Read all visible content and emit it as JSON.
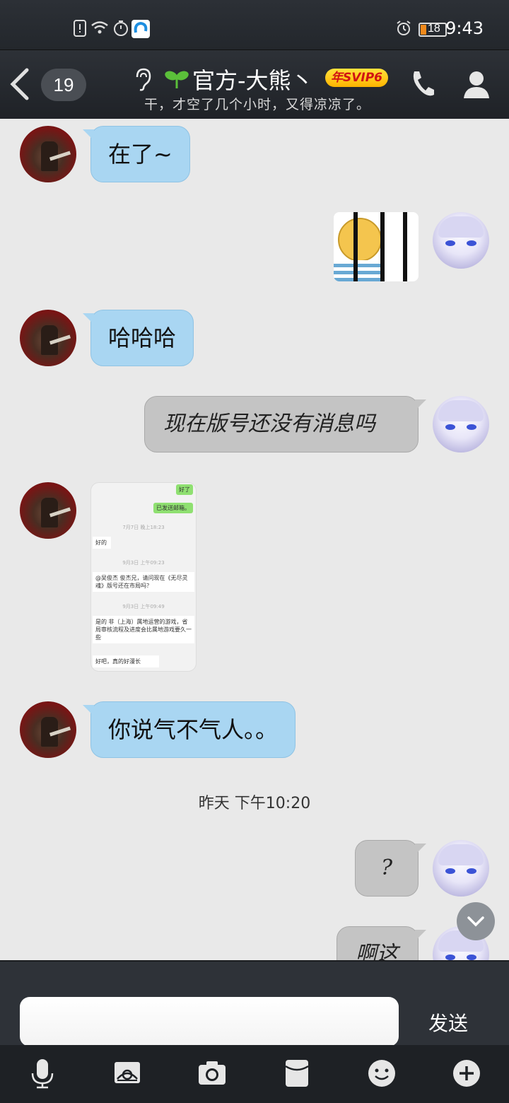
{
  "status_bar": {
    "battery": "18",
    "time": "9:43"
  },
  "header": {
    "unread_count": "19",
    "contact_name": "官方-大熊丶",
    "vip_badge": "年SVIP6",
    "signature": "干，才空了几个小时，又得凉凉了。"
  },
  "messages": {
    "m1": "在了~",
    "m3": "哈哈哈",
    "m4": "现在版号还没有消息吗",
    "m6": "你说气不气人。。",
    "m7": "?",
    "m8": "啊这"
  },
  "screenshot_texts": {
    "a": "好了",
    "b": "已发送邮箱。",
    "c": "7月7日 晚上18:23",
    "d": "好的",
    "e": "9月3日 上午09:23",
    "f": "@吴俊杰 俊杰兄，请问现在《无尽灵魂》版号还在市局吗？",
    "g": "9月3日 上午09:49",
    "h": "是的 非（上海）属地运营的游戏，省局审核流程及进度会比属地游戏要久一些",
    "i": "好吧，真的好漫长"
  },
  "timestamp": "昨天 下午10:20",
  "input": {
    "placeholder": "",
    "send_label": "发送"
  },
  "icons": [
    "back-icon",
    "ear-icon",
    "sprout-icon",
    "phone-icon",
    "profile-icon",
    "chevron-down-icon",
    "microphone-icon",
    "image-icon",
    "camera-icon",
    "red-packet-icon",
    "emoji-icon",
    "plus-icon"
  ],
  "colors": {
    "incoming_bubble": "#a9d6f2",
    "outgoing_bubble": "#c4c4c4",
    "vip": "#ffc21a",
    "header": "#2a2e33"
  }
}
